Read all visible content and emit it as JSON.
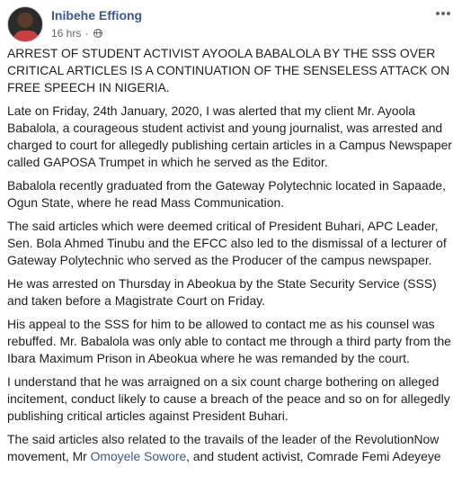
{
  "post": {
    "author": "Inibehe Effiong",
    "time": "16 hrs",
    "dot": "·",
    "paragraphs": [
      "ARREST OF STUDENT ACTIVIST AYOOLA BABALOLA BY THE SSS OVER CRITICAL ARTICLES IS A CONTINUATION OF THE SENSELESS ATTACK ON FREE SPEECH IN NIGERIA.",
      "Late on Friday, 24th January, 2020, I was alerted that my client Mr. Ayoola Babalola, a courageous student activist and young journalist, was arrested and charged to court for allegedly publishing certain articles in a Campus Newspaper called GAPOSA Trumpet in which he served as the Editor.",
      "Babalola recently graduated from the Gateway Polytechnic located in Sapaade, Ogun State, where he read Mass Communication.",
      "The said articles which were deemed critical of President Buhari, APC Leader, Sen. Bola Ahmed Tinubu and the EFCC also led to the dismissal of a lecturer of Gateway Polytechnic who served as the Producer of the campus newspaper.",
      "He was arrested on Thursday in Abeokua by the State Security Service (SSS) and taken before a Magistrate Court on Friday.",
      "His appeal to the SSS for him to be allowed to contact me as his counsel was rebuffed. Mr. Babalola was only able to contact me through a third party from the Ibara Maximum Prison in Abeokua where he was remanded by the court.",
      "I understand that he was arraigned on a six count charge bothering on alleged incitement, conduct likely to cause a breach of the peace and so on for allegedly publishing critical articles against President Buhari."
    ],
    "last_paragraph": {
      "before_link": "The said articles also related to the travails of the leader of the RevolutionNow movement, Mr ",
      "link": "Omoyele Sowore",
      "after_link": ", and student activist, Comrade Femi Adeyeye"
    }
  },
  "colors": {
    "link": "#385898",
    "meta": "#616770",
    "text": "#1c1e21"
  }
}
